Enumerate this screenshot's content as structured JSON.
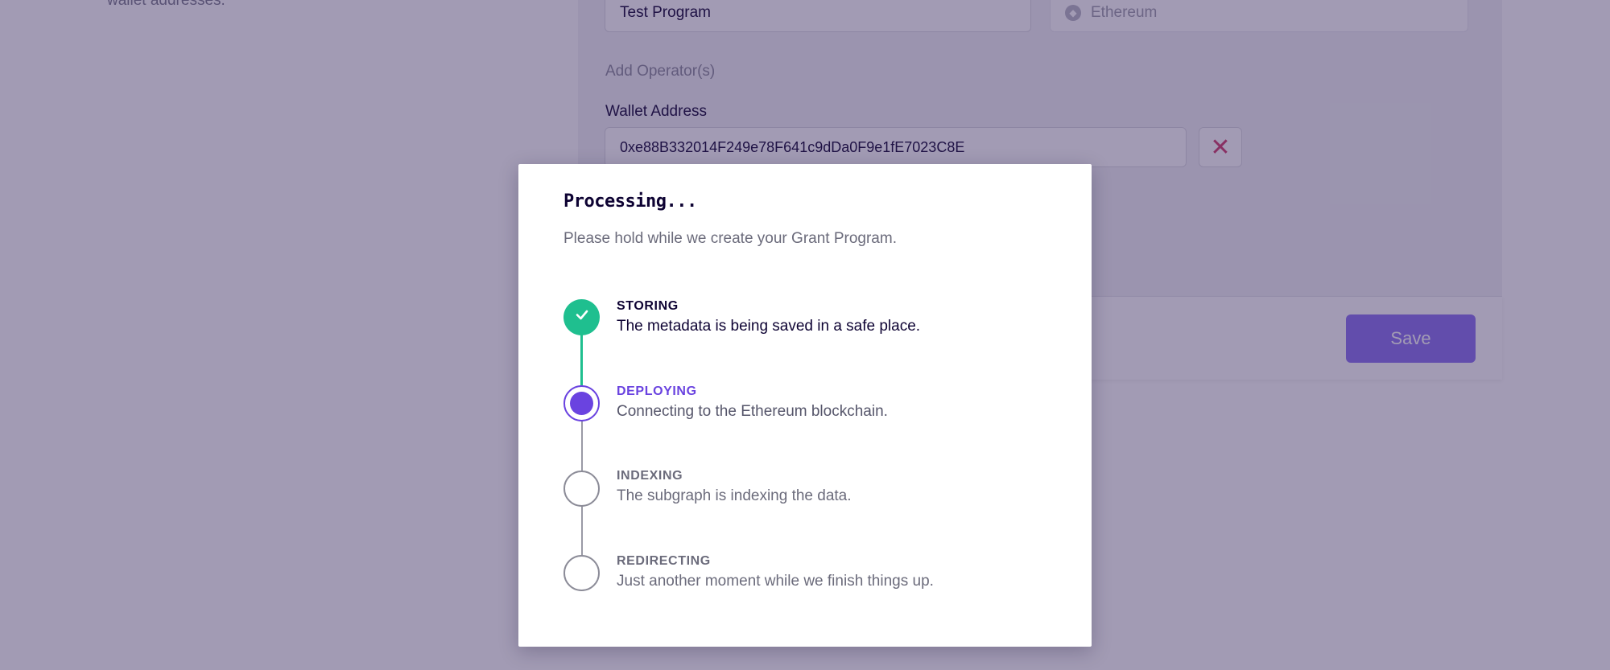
{
  "background": {
    "helper_text": "wallet addresses.",
    "program_name_value": "Test Program",
    "network_value": "Ethereum",
    "add_operators_label": "Add Operator(s)",
    "wallet_label": "Wallet Address",
    "wallet_value": "0xe88B332014F249e78F641c9dDa0F9e1fE7023C8E",
    "remove_symbol": "✕",
    "save_label": "Save"
  },
  "modal": {
    "title": "Processing...",
    "subtitle": "Please hold while we create your Grant Program.",
    "steps": [
      {
        "name": "STORING",
        "description": "The metadata is being saved in a safe place.",
        "status": "complete"
      },
      {
        "name": "DEPLOYING",
        "description": "Connecting to the Ethereum blockchain.",
        "status": "active"
      },
      {
        "name": "INDEXING",
        "description": "The subgraph is indexing the data.",
        "status": "pending"
      },
      {
        "name": "REDIRECTING",
        "description": "Just another moment while we finish things up.",
        "status": "pending"
      }
    ]
  },
  "colors": {
    "complete": "#1fbf8f",
    "active": "#6a43e0",
    "pending": "#8c8c98",
    "overlay": "#34265c",
    "save_button": "#8a6ff0"
  }
}
